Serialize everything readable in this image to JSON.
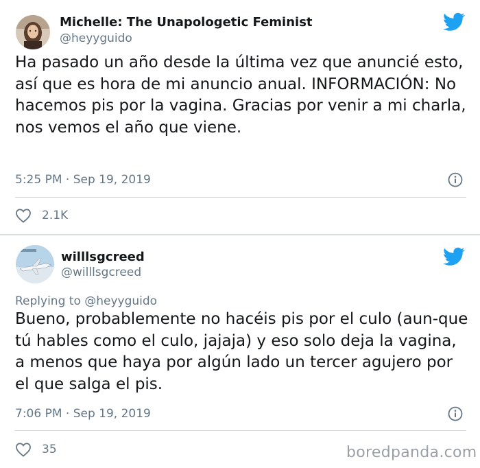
{
  "tweets": [
    {
      "display_name": "Michelle: The Unapologetic Feminist",
      "handle": "@heyyguido",
      "text": "Ha pasado un año desde la última vez que anuncié esto, así que es hora de mi anuncio anual. INFORMACIÓN: No hacemos pis por la vagina. Gracias por venir a mi charla, nos vemos el año que viene.",
      "timestamp": "5:25 PM · Sep 19, 2019",
      "likes": "2.1K",
      "icons": [
        "twitter-bird-icon",
        "info-icon",
        "heart-icon"
      ]
    },
    {
      "display_name": "willlsgcreed",
      "handle": "@willlsgcreed",
      "replying_to": "Replying to @heyyguido",
      "text": "Bueno, probablemente no hacéis pis por el culo (aun-que tú hables como el culo, jajaja) y eso solo deja la vagina, a menos que haya por algún lado un tercer agujero por el que salga el pis.",
      "timestamp": "7:06 PM · Sep 19, 2019",
      "likes": "35",
      "icons": [
        "twitter-bird-icon",
        "info-icon",
        "heart-icon"
      ]
    }
  ],
  "watermark": "boredpanda.com",
  "colors": {
    "twitter_blue": "#1da1f2",
    "secondary_text": "#657786",
    "primary_text": "#14171a"
  }
}
